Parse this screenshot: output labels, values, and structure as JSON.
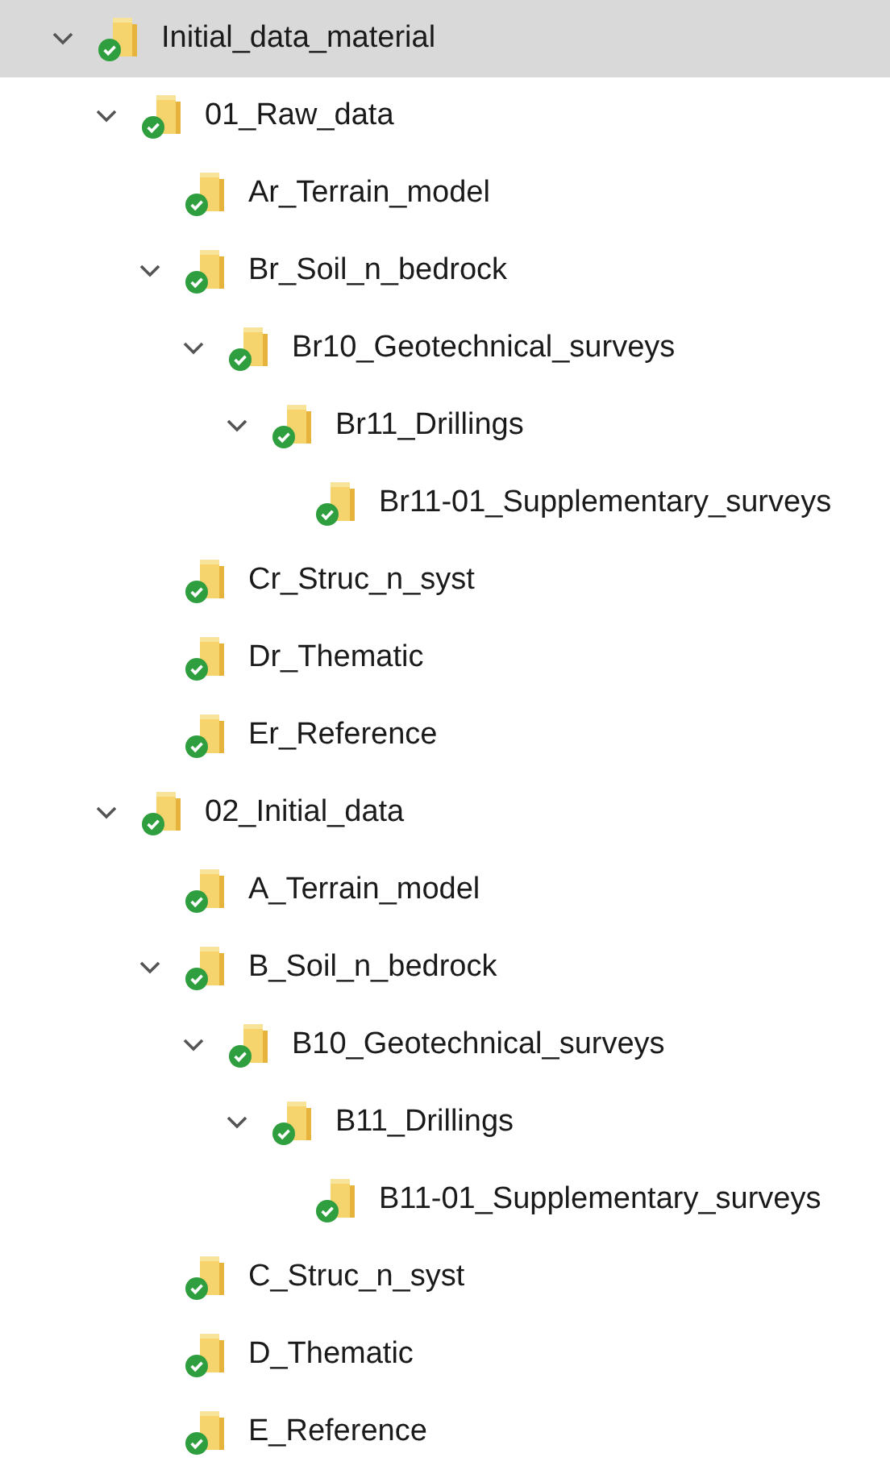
{
  "tree": [
    {
      "label": "Initial_data_material",
      "selected": true,
      "expanded": true,
      "children": [
        {
          "label": "01_Raw_data",
          "selected": false,
          "expanded": true,
          "children": [
            {
              "label": "Ar_Terrain_model",
              "selected": false
            },
            {
              "label": "Br_Soil_n_bedrock",
              "selected": false,
              "expanded": true,
              "children": [
                {
                  "label": "Br10_Geotechnical_surveys",
                  "selected": false,
                  "expanded": true,
                  "children": [
                    {
                      "label": "Br11_Drillings",
                      "selected": false,
                      "expanded": true,
                      "children": [
                        {
                          "label": "Br11-01_Supplementary_surveys",
                          "selected": false
                        }
                      ]
                    }
                  ]
                }
              ]
            },
            {
              "label": "Cr_Struc_n_syst",
              "selected": false
            },
            {
              "label": "Dr_Thematic",
              "selected": false
            },
            {
              "label": "Er_Reference",
              "selected": false
            }
          ]
        },
        {
          "label": "02_Initial_data",
          "selected": false,
          "expanded": true,
          "children": [
            {
              "label": "A_Terrain_model",
              "selected": false
            },
            {
              "label": "B_Soil_n_bedrock",
              "selected": false,
              "expanded": true,
              "children": [
                {
                  "label": "B10_Geotechnical_surveys",
                  "selected": false,
                  "expanded": true,
                  "children": [
                    {
                      "label": "B11_Drillings",
                      "selected": false,
                      "expanded": true,
                      "children": [
                        {
                          "label": "B11-01_Supplementary_surveys",
                          "selected": false
                        }
                      ]
                    }
                  ]
                }
              ]
            },
            {
              "label": "C_Struc_n_syst",
              "selected": false
            },
            {
              "label": "D_Thematic",
              "selected": false
            },
            {
              "label": "E_Reference",
              "selected": false
            }
          ]
        }
      ]
    }
  ]
}
